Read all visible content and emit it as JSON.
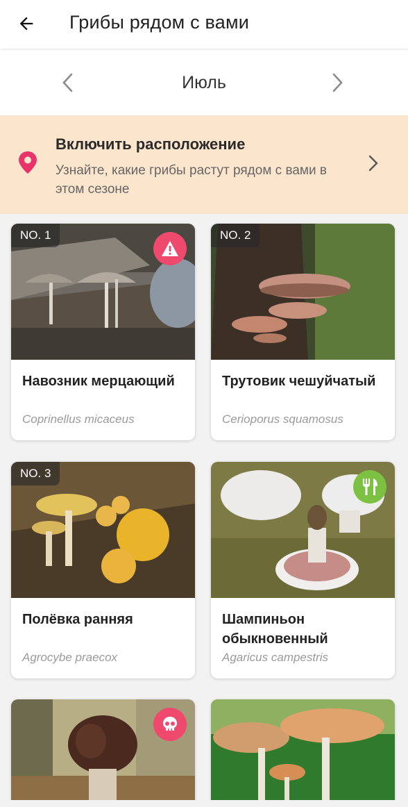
{
  "header": {
    "title": "Грибы рядом с вами",
    "back_icon": "arrow-left-icon"
  },
  "month_selector": {
    "label": "Июль",
    "prev_icon": "chevron-left-icon",
    "next_icon": "chevron-right-icon"
  },
  "location_banner": {
    "title": "Включить расположение",
    "text": "Узнайте, какие грибы растут рядом с вами в этом сезоне",
    "icon": "location-pin-icon",
    "chevron_icon": "chevron-right-icon",
    "background_color": "#fbe5cd",
    "icon_color": "#e8336b"
  },
  "cards": [
    {
      "rank": "NO. 1",
      "name": "Навозник мерцающий",
      "latin": "Coprinellus micaceus",
      "badge": "warning-icon",
      "badge_color": "#ef4a6d"
    },
    {
      "rank": "NO. 2",
      "name": "Трутовик чешуйчатый",
      "latin": "Cerioporus squamosus",
      "badge": "",
      "badge_color": ""
    },
    {
      "rank": "NO. 3",
      "name": "Полёвка ранняя",
      "latin": "Agrocybe praecox",
      "badge": "",
      "badge_color": ""
    },
    {
      "rank": "",
      "name": "Шампиньон обыкновенный",
      "latin": "Agaricus campestris",
      "badge": "edible-fork-knife-icon",
      "badge_color": "#7cc142"
    },
    {
      "rank": "",
      "name": "",
      "latin": "",
      "badge": "poison-skull-icon",
      "badge_color": "#ef4a6d"
    },
    {
      "rank": "",
      "name": "",
      "latin": "",
      "badge": "",
      "badge_color": ""
    }
  ]
}
